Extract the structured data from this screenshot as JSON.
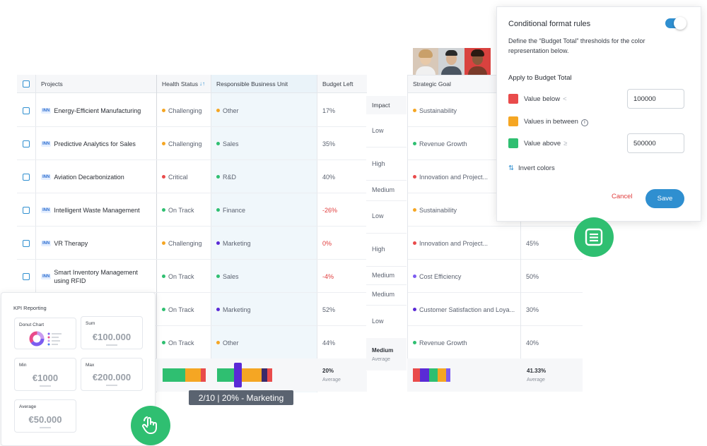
{
  "table": {
    "headers": {
      "projects": "Projects",
      "health": "Health Status",
      "health_sort_icon": "↓↑",
      "unit": "Responsible Business Unit",
      "budget": "Budget Left",
      "impact": "Impact",
      "goal": "Strategic Goal"
    },
    "tag": "INN",
    "rows": [
      {
        "project": "Energy-Efficient Manufacturing",
        "health": "Challenging",
        "unit": "Other",
        "budget": "17%",
        "goal": "Sustainability"
      },
      {
        "project": "Predictive Analytics for Sales",
        "health": "Challenging",
        "unit": "Sales",
        "budget": "35%",
        "goal": "Revenue Growth"
      },
      {
        "project": "Aviation Decarbonization",
        "health": "Critical",
        "unit": "R&D",
        "budget": "40%",
        "goal": "Innovation and Project..."
      },
      {
        "project": "Intelligent Waste Management",
        "health": "On Track",
        "unit": "Finance",
        "budget": "-26%",
        "goal": "Sustainability"
      },
      {
        "project": "VR Therapy",
        "health": "Challenging",
        "unit": "Marketing",
        "budget": "0%",
        "goal": "Innovation and Project...",
        "goal_pct": "45%"
      },
      {
        "project": "Smart Inventory Management using RFID",
        "health": "On Track",
        "unit": "Sales",
        "budget": "-4%",
        "goal": "Cost Efficiency",
        "goal_pct": "50%"
      },
      {
        "project": "",
        "health": "On Track",
        "unit": "Marketing",
        "budget": "52%",
        "goal": "Customer Satisfaction and Loya...",
        "goal_pct": "30%"
      },
      {
        "project": "",
        "health": "On Track",
        "unit": "Other",
        "budget": "44%",
        "goal": "Revenue Growth",
        "goal_pct": "40%"
      }
    ],
    "impact_values": [
      "Low",
      "High",
      "Medium",
      "Low",
      "High",
      "Medium",
      "Medium",
      "Low"
    ],
    "summary": {
      "budget_avg": "20%",
      "avg_label": "Average",
      "impact_avg": "Medium",
      "goal_avg": "41.33%"
    }
  },
  "colors": {
    "challenging": "#f5a623",
    "critical": "#e94b4b",
    "on_track": "#2fbf71",
    "unit_other": "#f5a623",
    "unit_sales": "#2fbf71",
    "unit_rnd": "#2fbf71",
    "unit_finance": "#2fbf71",
    "unit_marketing": "#5a2ad6",
    "goal_sustainability": "#f5a623",
    "goal_revenue": "#2fbf71",
    "goal_innovation": "#e94b4b",
    "goal_cost": "#7c5cf0",
    "goal_customer": "#5a2ad6",
    "accent": "#2f8fd0"
  },
  "popover": {
    "title": "Conditional format rules",
    "description": "Define the “Budget Total” thresholds for the color representation below.",
    "apply_label": "Apply to Budget Total",
    "rule_below": "Value below",
    "rule_between": "Values in between",
    "rule_above": "Value above",
    "below_value": "100000",
    "above_value": "500000",
    "invert": "Invert colors",
    "cancel": "Cancel",
    "save": "Save",
    "swatches": {
      "below": "#e94b4b",
      "between": "#f5a623",
      "above": "#2fbf71"
    }
  },
  "kpi": {
    "title": "KPI Reporting",
    "donut_label": "Donut Chart",
    "sum_label": "Sum",
    "sum_value": "€100.000",
    "min_label": "Min",
    "min_value": "€1000",
    "max_label": "Max",
    "max_value": "€200.000",
    "avg_label": "Average",
    "avg_value": "€50.000"
  },
  "tooltip": "2/10 | 20% - Marketing",
  "icons": {
    "avatars": [
      "avatar-woman",
      "avatar-man",
      "avatar-woman-2"
    ],
    "badge_top": "table-list-icon",
    "badge_bottom": "hand-pointer-icon"
  }
}
